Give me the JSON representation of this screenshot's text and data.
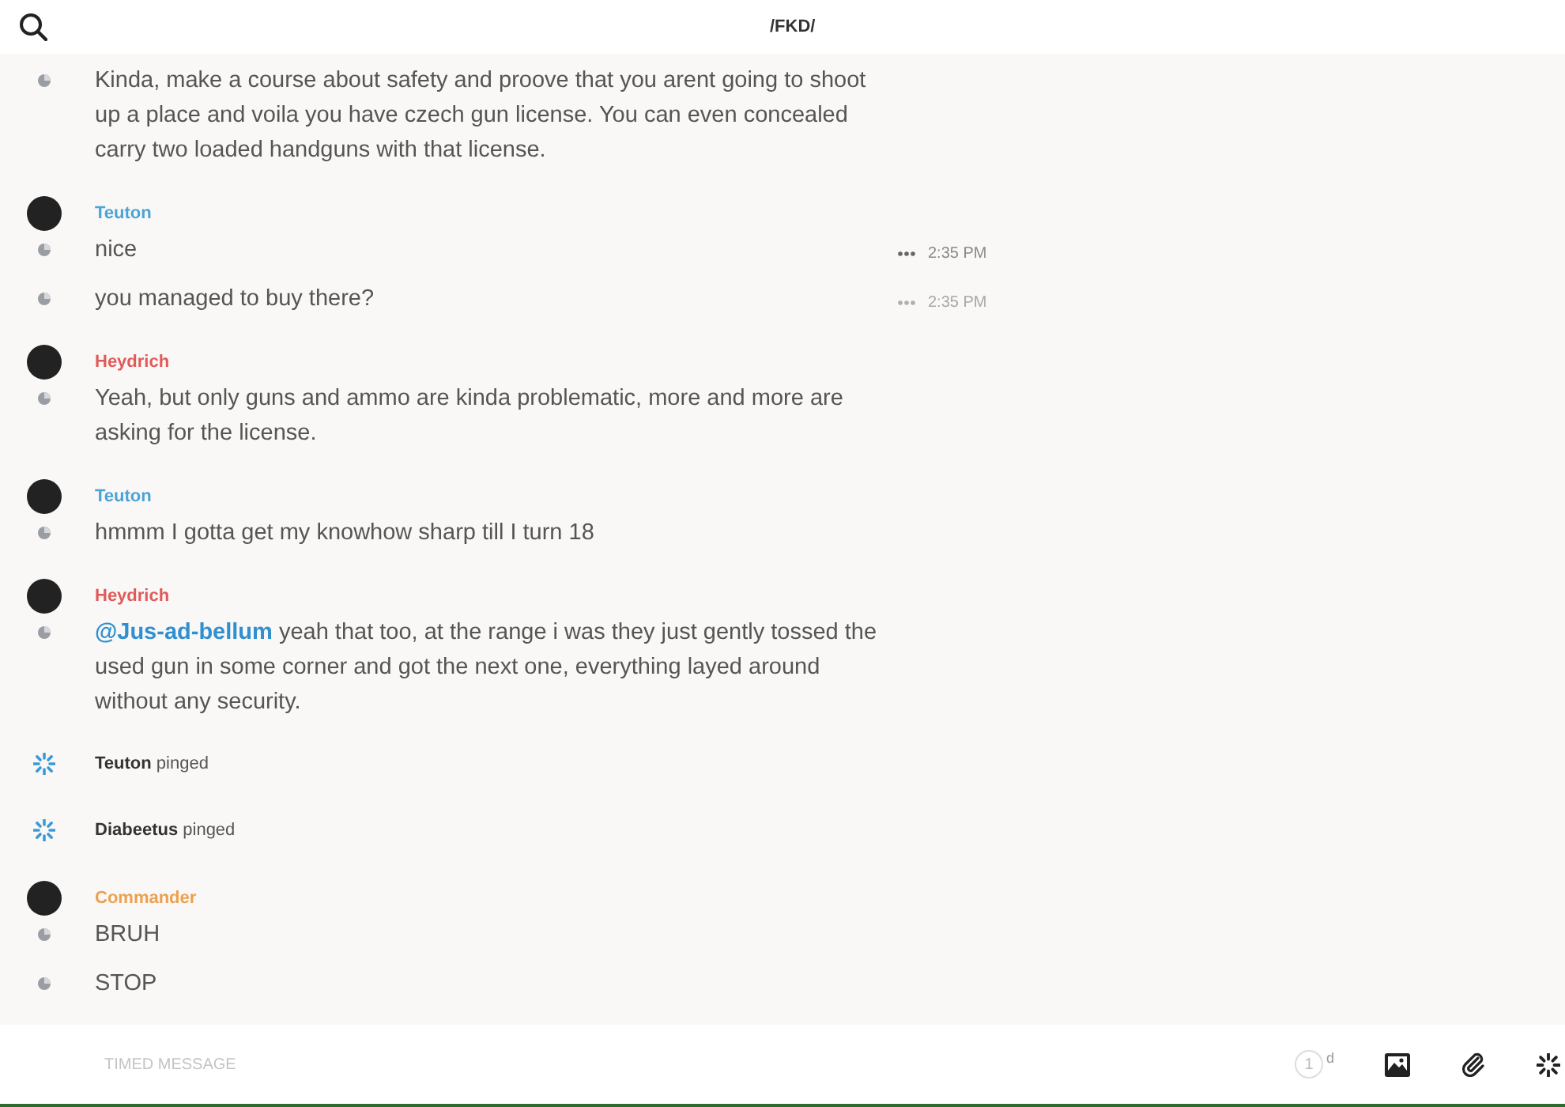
{
  "header": {
    "title": "/FKD/"
  },
  "messages": [
    {
      "kind": "message",
      "lines": [
        {
          "text": "Kinda, make a course about safety and proove that you arent going to shoot up a place and voila you have czech gun license. You can even concealed carry two loaded handguns with that license."
        }
      ]
    },
    {
      "kind": "message",
      "author": "Teuton",
      "color": "#4ba3d6",
      "lines": [
        {
          "text": "nice",
          "time": "2:35 PM",
          "hovered": true
        },
        {
          "text": "you managed to buy there?",
          "time": "2:35 PM",
          "hovered": false
        }
      ]
    },
    {
      "kind": "message",
      "author": "Heydrich",
      "color": "#e05a5a",
      "lines": [
        {
          "text": "Yeah, but only guns and ammo are kinda problematic, more and more are asking for the license."
        }
      ]
    },
    {
      "kind": "message",
      "author": "Teuton",
      "color": "#4ba3d6",
      "lines": [
        {
          "text": "hmmm I gotta get my knowhow sharp till I turn 18"
        }
      ]
    },
    {
      "kind": "message",
      "author": "Heydrich",
      "color": "#e05a5a",
      "lines": [
        {
          "mention": "@Jus-ad-bellum",
          "text": "yeah that too, at the range i was they just gently tossed the used gun in some corner and got the next one, everything layed around without any security."
        }
      ]
    },
    {
      "kind": "ping",
      "author": "Teuton",
      "text": "pinged"
    },
    {
      "kind": "ping",
      "author": "Diabeetus",
      "text": "pinged"
    },
    {
      "kind": "message",
      "author": "Commander",
      "color": "#eda04f",
      "lines": [
        {
          "text": "BRUH"
        },
        {
          "text": "STOP"
        }
      ]
    }
  ],
  "composer": {
    "placeholder": "TIMED MESSAGE",
    "timer_value": "1",
    "timer_unit": "d"
  }
}
